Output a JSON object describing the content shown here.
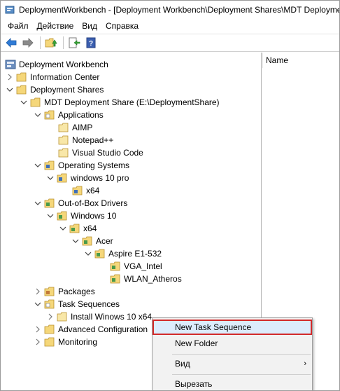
{
  "window": {
    "title": "DeploymentWorkbench - [Deployment Workbench\\Deployment Shares\\MDT Deployme"
  },
  "menu": {
    "file": "Файл",
    "action": "Действие",
    "view": "Вид",
    "help": "Справка"
  },
  "toolbar": {
    "icons": [
      "back-icon",
      "forward-icon",
      "up-folder-icon",
      "export-icon",
      "help-icon"
    ]
  },
  "tree": {
    "root": "Deployment Workbench",
    "information_center": "Information Center",
    "deployment_shares": "Deployment Shares",
    "mdt_share": "MDT Deployment Share (E:\\DeploymentShare)",
    "applications": "Applications",
    "aimp": "AIMP",
    "notepadpp": "Notepad++",
    "vscode": "Visual Studio Code",
    "operating_systems": "Operating Systems",
    "win10pro": "windows 10 pro",
    "os_x64": "x64",
    "drivers": "Out-of-Box Drivers",
    "drv_win10": "Windows 10",
    "drv_x64": "x64",
    "acer": "Acer",
    "aspire": "Aspire E1-532",
    "vga": "VGA_Intel",
    "wlan": "WLAN_Atheros",
    "packages": "Packages",
    "task_sequences": "Task Sequences",
    "install_win10": "Install Winows 10 x64",
    "advanced_config": "Advanced Configuration",
    "monitoring": "Monitoring"
  },
  "details": {
    "column_name": "Name"
  },
  "context_menu": {
    "new_task_sequence": "New Task Sequence",
    "new_folder": "New Folder",
    "view": "Вид",
    "cut": "Вырезать",
    "submenu_arrow": "›"
  },
  "colors": {
    "folder_fill": "#f5d77a",
    "folder_edge": "#b8902e",
    "selection": "#dcecfc",
    "highlight_border": "#d32a2a"
  }
}
